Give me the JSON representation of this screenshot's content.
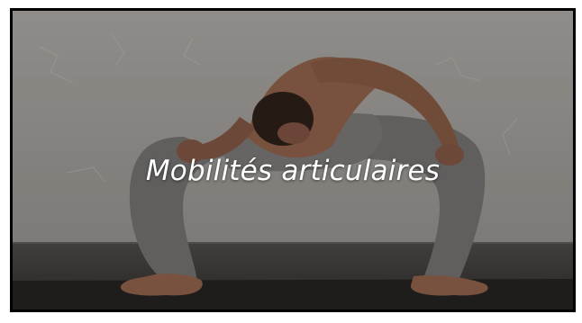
{
  "slide": {
    "title": "Mobilités articulaires",
    "background_image": "man-yoga-deep-squat-side-bend-photo",
    "colors": {
      "frame": "#000000",
      "wall": "#9a9794",
      "floor": "#3a3836",
      "mat": "#2a2826",
      "skin": "#8a5e48",
      "pants": "#6f6d6b",
      "hair": "#2b1e17",
      "title_text": "#ffffff"
    }
  }
}
